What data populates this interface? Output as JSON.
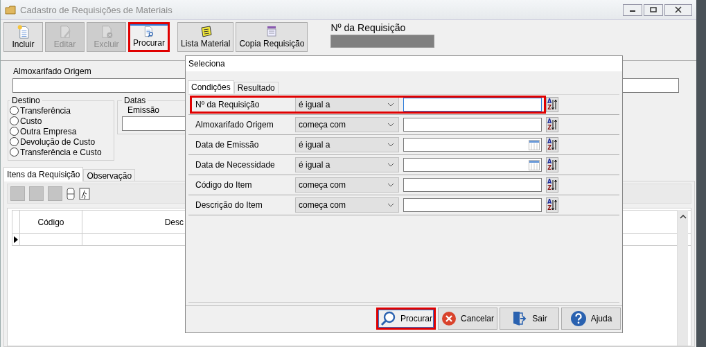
{
  "window": {
    "title": "Cadastro de Requisições de Materiais",
    "active": false
  },
  "toolbar": [
    {
      "label": "Incluir",
      "kind": "new",
      "disabled": false,
      "highlighted": false
    },
    {
      "label": "Editar",
      "kind": "edit",
      "disabled": true,
      "highlighted": false
    },
    {
      "label": "Excluir",
      "kind": "delete",
      "disabled": true,
      "highlighted": false
    },
    {
      "label": "Procurar",
      "kind": "search",
      "disabled": false,
      "highlighted": true
    },
    {
      "label": "Lista Material",
      "kind": "list",
      "disabled": false,
      "highlighted": false
    },
    {
      "label": "Copia Requisição",
      "kind": "copy",
      "disabled": false,
      "highlighted": false
    }
  ],
  "requisition_number": {
    "label": "Nº da Requisição",
    "disabled": true
  },
  "form": {
    "origin_label": "Almoxarifado Origem",
    "destino": {
      "title": "Destino",
      "options": [
        {
          "label": "Transferência",
          "selected": false
        },
        {
          "label": "Custo",
          "selected": false
        },
        {
          "label": "Outra Empresa",
          "selected": false
        },
        {
          "label": "Devolução de Custo",
          "selected": false
        },
        {
          "label": "Transferência e Custo",
          "selected": false
        }
      ]
    },
    "datas": {
      "title": "Datas",
      "emission_label": "Emissão"
    }
  },
  "tabs": [
    {
      "label": "Itens da Requisição",
      "selected": true
    },
    {
      "label": "Observação",
      "selected": false
    }
  ],
  "grid": {
    "columns": [
      "Código",
      "Desc"
    ]
  },
  "dialog": {
    "title": "Seleciona",
    "tabs": [
      {
        "label": "Condições",
        "selected": true
      },
      {
        "label": "Resultado",
        "selected": false
      }
    ],
    "conditions": [
      {
        "field": "Nº  da Requisição",
        "operator": "é igual a",
        "kind": "text",
        "highlighted": true,
        "focused": true,
        "sort": [
          "A",
          "Z"
        ]
      },
      {
        "field": "Almoxarifado Origem",
        "operator": "começa com",
        "kind": "text",
        "highlighted": false,
        "focused": false,
        "sort": [
          "A",
          "Z"
        ]
      },
      {
        "field": "Data de Emissão",
        "operator": "é igual a",
        "kind": "date",
        "highlighted": false,
        "focused": false,
        "sort": [
          "A",
          "Z"
        ]
      },
      {
        "field": "Data de Necessidade",
        "operator": "é igual a",
        "kind": "date",
        "highlighted": false,
        "focused": false,
        "sort": [
          "A",
          "Z"
        ]
      },
      {
        "field": "Código do Item",
        "operator": "começa com",
        "kind": "text",
        "highlighted": false,
        "focused": false,
        "sort": [
          "A",
          "Z"
        ]
      },
      {
        "field": "Descrição do Item",
        "operator": "começa com",
        "kind": "text",
        "highlighted": false,
        "focused": false,
        "sort": [
          "A",
          "Z"
        ]
      }
    ],
    "buttons": [
      {
        "label": "Procurar",
        "kind": "search",
        "highlighted": true
      },
      {
        "label": "Cancelar",
        "kind": "cancel",
        "highlighted": false
      },
      {
        "label": "Sair",
        "kind": "exit",
        "highlighted": false
      },
      {
        "label": "Ajuda",
        "kind": "help",
        "highlighted": false
      }
    ]
  }
}
